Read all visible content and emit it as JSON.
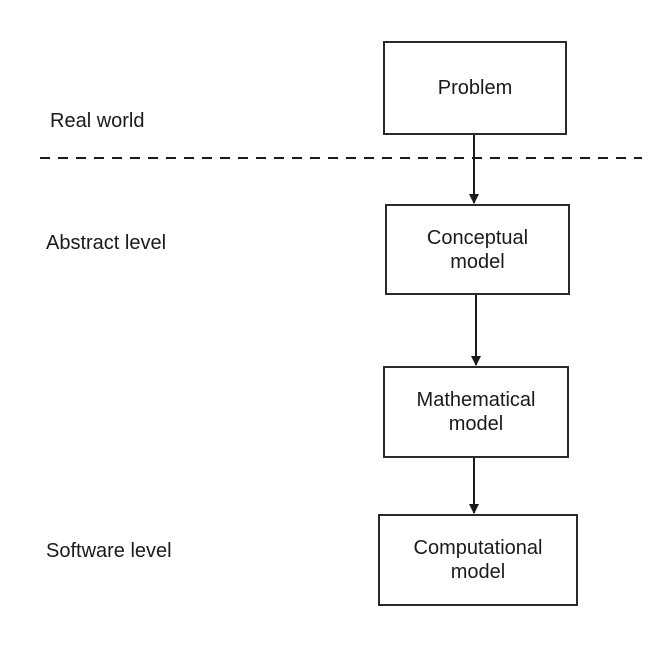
{
  "levels": {
    "real_world": "Real world",
    "abstract": "Abstract level",
    "software": "Software level"
  },
  "boxes": {
    "problem": [
      "Problem"
    ],
    "conceptual": [
      "Conceptual",
      "model"
    ],
    "mathematical": [
      "Mathematical",
      "model"
    ],
    "computational": [
      "Computational",
      "model"
    ]
  }
}
